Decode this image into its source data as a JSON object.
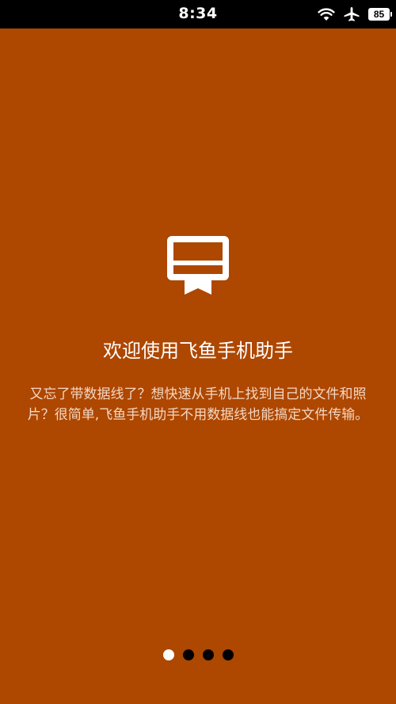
{
  "status_bar": {
    "time": "8:34",
    "icons": [
      "wifi-icon",
      "airplane-icon",
      "battery-icon"
    ],
    "battery_level": "85"
  },
  "colors": {
    "background": "#ae4700",
    "status_bar": "#000000",
    "text": "#ffffff",
    "dot_active": "#ffffff",
    "dot_inactive": "#000000"
  },
  "onboarding": {
    "icon": "ticket-card-icon",
    "title": "欢迎使用飞鱼手机助手",
    "description": "又忘了带数据线了？想快速从手机上找到自己的文件和照片？很简单,飞鱼手机助手不用数据线也能搞定文件传输。"
  },
  "pager": {
    "total_pages": 4,
    "current_page": 1
  }
}
